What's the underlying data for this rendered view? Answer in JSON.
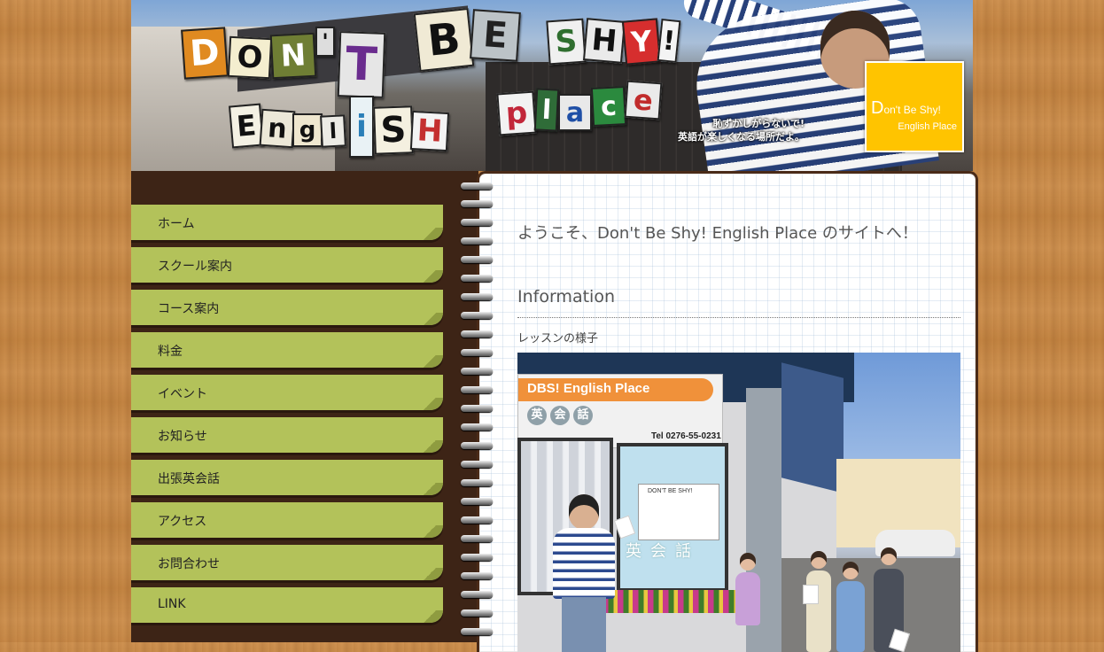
{
  "header": {
    "logo_letters": {
      "line1": [
        "D",
        "O",
        "N",
        "'",
        "T",
        "B",
        "E",
        "S",
        "H",
        "Y",
        "!"
      ],
      "line2": [
        "E",
        "n",
        "g",
        "l",
        "i",
        "S",
        "H"
      ],
      "line3": [
        "p",
        "l",
        "a",
        "c",
        "e"
      ]
    },
    "tagline_line1": "恥ずかしがらないで!",
    "tagline_line2": "英語が楽しくなる場所だよ。",
    "logo_box_line1_first": "D",
    "logo_box_line1_rest": "on't Be Shy!",
    "logo_box_line2": "English Place",
    "colors": {
      "logo_box": "#ffc400"
    }
  },
  "sidebar": {
    "items": [
      {
        "label": "ホーム"
      },
      {
        "label": "スクール案内"
      },
      {
        "label": "コース案内"
      },
      {
        "label": "料金"
      },
      {
        "label": "イベント"
      },
      {
        "label": "お知らせ"
      },
      {
        "label": "出張英会話"
      },
      {
        "label": "アクセス"
      },
      {
        "label": "お問合わせ"
      },
      {
        "label": "LINK"
      }
    ],
    "colors": {
      "tab": "#b3c25a",
      "background": "#3d2416"
    }
  },
  "main": {
    "welcome": "ようこそ、Don't Be Shy! English Place のサイトへ！",
    "info_heading": "Information",
    "lesson_caption": "レッスンの様子",
    "photo": {
      "sign_title": "DBS! English Place",
      "sign_kanji": [
        "英",
        "会",
        "話"
      ],
      "sign_tel": "Tel 0276-55-0231",
      "poster_title": "DON'T BE SHY!",
      "window_text": "英会話"
    }
  }
}
